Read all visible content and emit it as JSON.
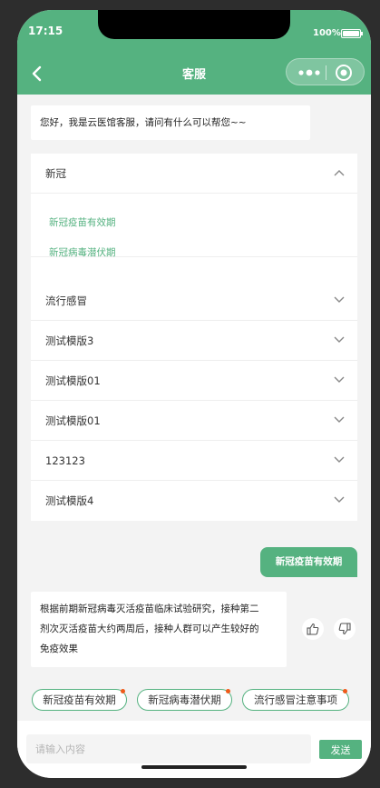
{
  "status": {
    "time": "17:15",
    "battery": "100%"
  },
  "nav": {
    "title": "客服"
  },
  "greeting": "您好，我是云医馆客服，请问有什么可以帮您~~",
  "faq": {
    "expanded_title": "新冠",
    "expanded_items": [
      "新冠疫苗有效期",
      "新冠病毒潜伏期"
    ],
    "collapsed_items": [
      "流行感冒",
      "测试模版3",
      "测试模版01",
      "测试模版01",
      "123123",
      "测试模版4"
    ]
  },
  "user_message": "新冠疫苗有效期",
  "answer": {
    "lines": [
      "根据前期新冠病毒灭活疫苗临床试验研究，接种第二",
      "剂次灭活疫苗大约两周后，接种人群可以产生较好的",
      "免疫效果"
    ]
  },
  "quick_tags": [
    "新冠疫苗有效期",
    "新冠病毒潜伏期",
    "流行感冒注意事项"
  ],
  "input": {
    "placeholder": "请输入内容",
    "value": "",
    "send_label": "发送"
  },
  "colors": {
    "brand": "#55b280",
    "badge": "#f05a1a"
  }
}
